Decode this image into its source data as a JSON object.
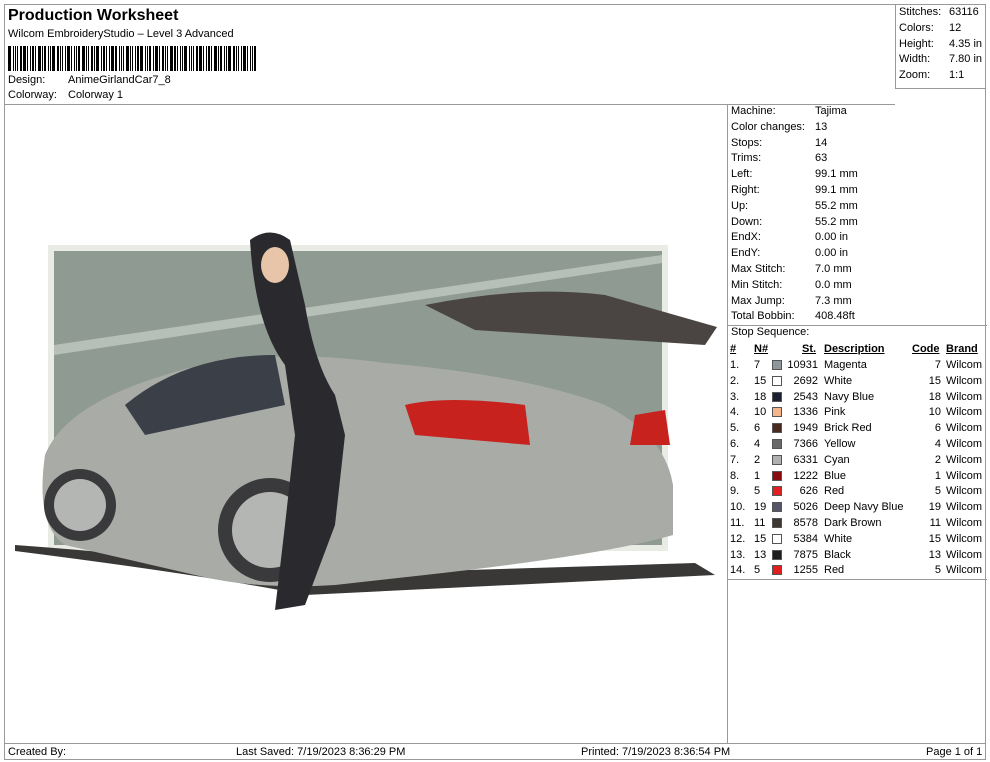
{
  "header": {
    "title": "Production Worksheet",
    "software": "Wilcom EmbroideryStudio – Level 3 Advanced",
    "design_label": "Design:",
    "design": "AnimeGirlandCar7_8",
    "colorway_label": "Colorway:",
    "colorway": "Colorway 1"
  },
  "stats": [
    {
      "label": "Stitches:",
      "value": "63116"
    },
    {
      "label": "Colors:",
      "value": "12"
    },
    {
      "label": "Height:",
      "value": "4.35 in"
    },
    {
      "label": "Width:",
      "value": "7.80 in"
    },
    {
      "label": "Zoom:",
      "value": "1:1"
    }
  ],
  "info": [
    {
      "label": "Machine:",
      "value": "Tajima"
    },
    {
      "label": "Color changes:",
      "value": "13"
    },
    {
      "label": "Stops:",
      "value": "14"
    },
    {
      "label": "Trims:",
      "value": "63"
    },
    {
      "label": "Left:",
      "value": "99.1 mm"
    },
    {
      "label": "Right:",
      "value": "99.1 mm"
    },
    {
      "label": "Up:",
      "value": "55.2 mm"
    },
    {
      "label": "Down:",
      "value": "55.2 mm"
    },
    {
      "label": "EndX:",
      "value": "0.00 in"
    },
    {
      "label": "EndY:",
      "value": "0.00 in"
    },
    {
      "label": "Max Stitch:",
      "value": "7.0 mm"
    },
    {
      "label": "Min Stitch:",
      "value": "0.0 mm"
    },
    {
      "label": "Max Jump:",
      "value": "7.3 mm"
    },
    {
      "label": "Total Bobbin:",
      "value": "408.48ft"
    }
  ],
  "stop_sequence": {
    "title": "Stop Sequence:",
    "headers": {
      "num": "#",
      "n": "N#",
      "st": "St.",
      "desc": "Description",
      "code": "Code",
      "brand": "Brand"
    },
    "rows": [
      {
        "num": "1.",
        "n": "7",
        "color": "#8e989a",
        "st": "10931",
        "desc": "Magenta",
        "code": "7",
        "brand": "Wilcom"
      },
      {
        "num": "2.",
        "n": "15",
        "color": "#ffffff",
        "st": "2692",
        "desc": "White",
        "code": "15",
        "brand": "Wilcom"
      },
      {
        "num": "3.",
        "n": "18",
        "color": "#1c2033",
        "st": "2543",
        "desc": "Navy Blue",
        "code": "18",
        "brand": "Wilcom"
      },
      {
        "num": "4.",
        "n": "10",
        "color": "#f4b48c",
        "st": "1336",
        "desc": "Pink",
        "code": "10",
        "brand": "Wilcom"
      },
      {
        "num": "5.",
        "n": "6",
        "color": "#4a2a1e",
        "st": "1949",
        "desc": "Brick Red",
        "code": "6",
        "brand": "Wilcom"
      },
      {
        "num": "6.",
        "n": "4",
        "color": "#6a6a6a",
        "st": "7366",
        "desc": "Yellow",
        "code": "4",
        "brand": "Wilcom"
      },
      {
        "num": "7.",
        "n": "2",
        "color": "#b0b0b0",
        "st": "6331",
        "desc": "Cyan",
        "code": "2",
        "brand": "Wilcom"
      },
      {
        "num": "8.",
        "n": "1",
        "color": "#8a0c10",
        "st": "1222",
        "desc": "Blue",
        "code": "1",
        "brand": "Wilcom"
      },
      {
        "num": "9.",
        "n": "5",
        "color": "#e02020",
        "st": "626",
        "desc": "Red",
        "code": "5",
        "brand": "Wilcom"
      },
      {
        "num": "10.",
        "n": "19",
        "color": "#565468",
        "st": "5026",
        "desc": "Deep Navy Blue",
        "code": "19",
        "brand": "Wilcom"
      },
      {
        "num": "11.",
        "n": "11",
        "color": "#3e3632",
        "st": "8578",
        "desc": "Dark Brown",
        "code": "11",
        "brand": "Wilcom"
      },
      {
        "num": "12.",
        "n": "15",
        "color": "#ffffff",
        "st": "5384",
        "desc": "White",
        "code": "15",
        "brand": "Wilcom"
      },
      {
        "num": "13.",
        "n": "13",
        "color": "#1e1e1e",
        "st": "7875",
        "desc": "Black",
        "code": "13",
        "brand": "Wilcom"
      },
      {
        "num": "14.",
        "n": "5",
        "color": "#e01e1e",
        "st": "1255",
        "desc": "Red",
        "code": "5",
        "brand": "Wilcom"
      }
    ]
  },
  "footer": {
    "created": "Created By:",
    "saved": "Last Saved: 7/19/2023 8:36:29 PM",
    "printed": "Printed: 7/19/2023 8:36:54 PM",
    "page": "Page 1 of 1"
  }
}
